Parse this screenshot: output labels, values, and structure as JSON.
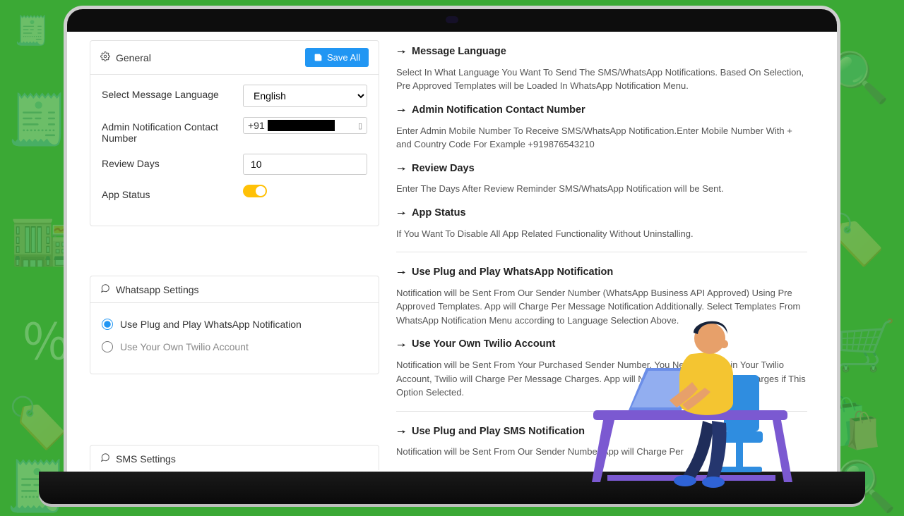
{
  "general": {
    "header_label": "General",
    "save_label": "Save All",
    "language_label": "Select Message Language",
    "language_value": "English",
    "admin_contact_label": "Admin Notification Contact Number",
    "phone_prefix": "+91",
    "review_days_label": "Review Days",
    "review_days_value": "10",
    "app_status_label": "App Status",
    "app_status_on": true
  },
  "whatsapp_card": {
    "header_label": "Whatsapp Settings",
    "opt_plug": "Use Plug and Play WhatsApp Notification",
    "opt_twilio": "Use Your Own Twilio Account",
    "selected": "plug"
  },
  "sms_card": {
    "header_label": "SMS Settings"
  },
  "help": {
    "msg_lang_title": "Message Language",
    "msg_lang_body": "Select In What Language You Want To Send The SMS/WhatsApp Notifications. Based On Selection, Pre Approved Templates will be Loaded In WhatsApp Notification Menu.",
    "admin_title": "Admin Notification Contact Number",
    "admin_body": "Enter Admin Mobile Number To Receive SMS/WhatsApp Notification.Enter Mobile Number With + and Country Code For Example +919876543210",
    "review_title": "Review Days",
    "review_body": "Enter The Days After Review Reminder SMS/WhatsApp Notification will be Sent.",
    "status_title": "App Status",
    "status_body": "If You Want To Disable All App Related Functionality Without Uninstalling.",
    "wa_plug_title": "Use Plug and Play WhatsApp Notification",
    "wa_plug_body": "Notification will be Sent From Our Sender Number (WhatsApp Business API Approved) Using Pre Approved Templates. App will Charge Per Message Notification Additionally. Select Templates From WhatsApp Notification Menu according to Language Selection Above.",
    "wa_twilio_title": "Use Your Own Twilio Account",
    "wa_twilio_body": "Notification will be Sent From Your Purchased Sender Number. You Need to Fund in Your Twilio Account, Twilio will Charge Per Message Charges. App will Not Charge Per Message Charges if This Option Selected.",
    "sms_plug_title": "Use Plug and Play SMS Notification",
    "sms_plug_body": "Notification will be Sent From Our Sender Number.App will Charge Per"
  }
}
